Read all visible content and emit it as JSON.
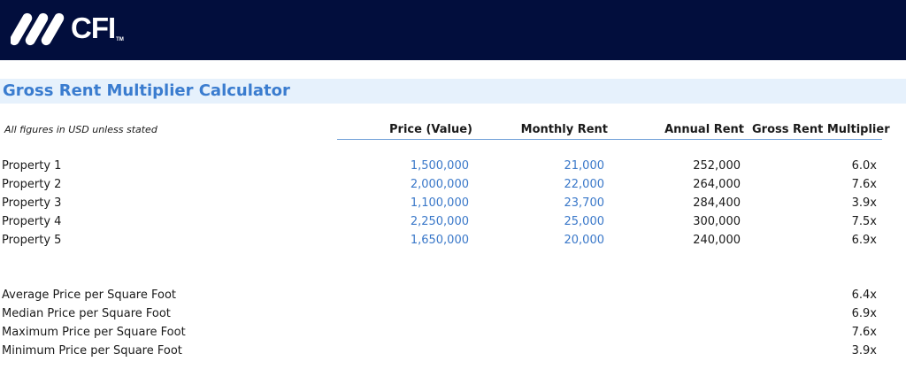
{
  "brand": {
    "name": "CFI",
    "tm": "TM",
    "colors": {
      "header_bg": "#020e3d",
      "title_band": "#e6f1fc",
      "title_text": "#3a7ccf",
      "input_blue": "#3a78c9"
    }
  },
  "title": "Gross Rent Multiplier Calculator",
  "note": "All figures in USD unless stated",
  "columns": {
    "price": "Price (Value)",
    "monthly_rent": "Monthly Rent",
    "annual_rent": "Annual Rent",
    "grm": "Gross Rent Multiplier"
  },
  "properties": [
    {
      "name": "Property 1",
      "price": "1,500,000",
      "monthly_rent": "21,000",
      "annual_rent": "252,000",
      "grm": "6.0x"
    },
    {
      "name": "Property 2",
      "price": "2,000,000",
      "monthly_rent": "22,000",
      "annual_rent": "264,000",
      "grm": "7.6x"
    },
    {
      "name": "Property 3",
      "price": "1,100,000",
      "monthly_rent": "23,700",
      "annual_rent": "284,400",
      "grm": "3.9x"
    },
    {
      "name": "Property 4",
      "price": "2,250,000",
      "monthly_rent": "25,000",
      "annual_rent": "300,000",
      "grm": "7.5x"
    },
    {
      "name": "Property 5",
      "price": "1,650,000",
      "monthly_rent": "20,000",
      "annual_rent": "240,000",
      "grm": "6.9x"
    }
  ],
  "summary": [
    {
      "label": "Average Price per Square Foot",
      "value": "6.4x"
    },
    {
      "label": "Median Price per Square Foot",
      "value": "6.9x"
    },
    {
      "label": "Maximum Price per Square Foot",
      "value": "7.6x"
    },
    {
      "label": "Minimum Price per Square Foot",
      "value": "3.9x"
    }
  ]
}
